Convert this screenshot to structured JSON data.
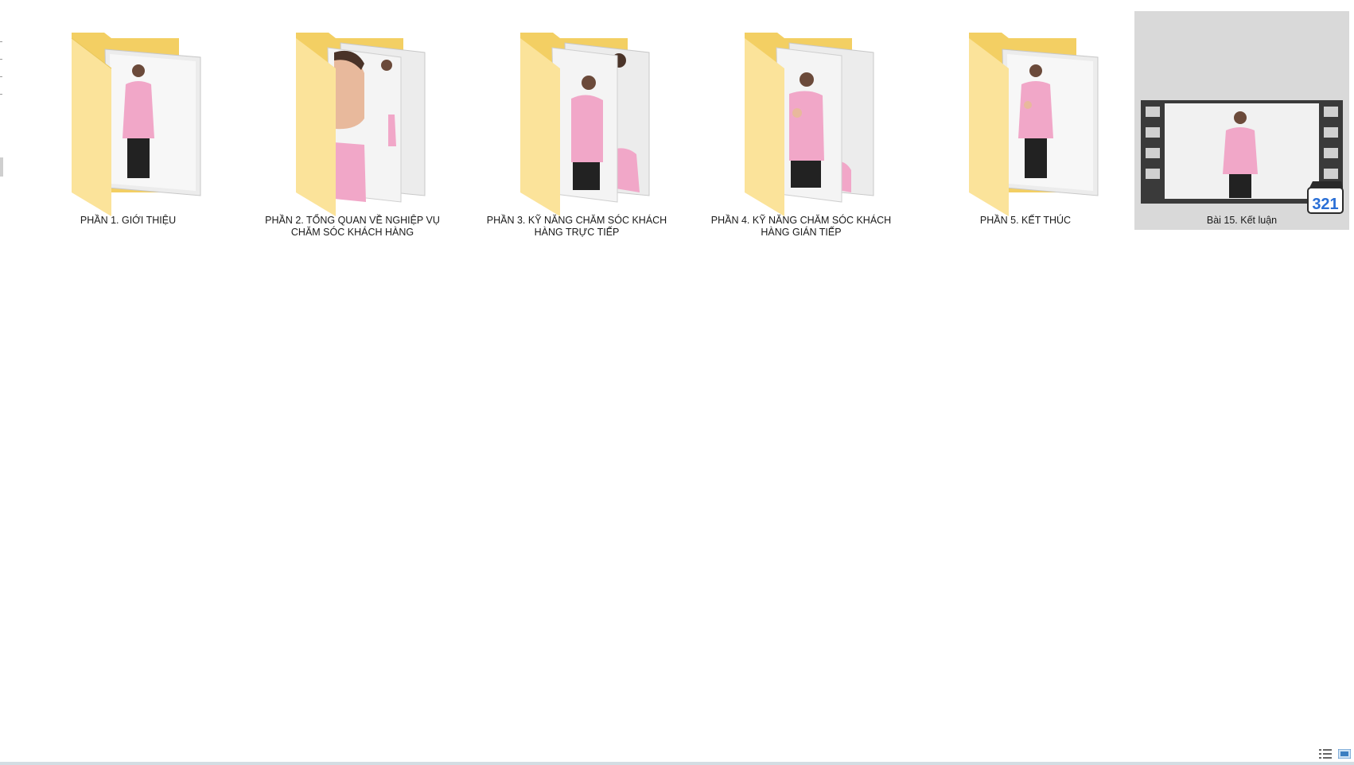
{
  "window": {
    "view_mode": "large-icons"
  },
  "items": [
    {
      "type": "folder",
      "icon": "folder-icon",
      "label": "PHẦN 1. GIỚI THIỆU",
      "selected": false
    },
    {
      "type": "folder",
      "icon": "folder-icon",
      "label": "PHẦN 2. TỔNG QUAN VỀ NGHIỆP VỤ CHĂM SÓC KHÁCH HÀNG",
      "selected": false
    },
    {
      "type": "folder",
      "icon": "folder-icon",
      "label": "PHẦN 3. KỸ NĂNG CHĂM SÓC KHÁCH HÀNG TRỰC TIẾP",
      "selected": false
    },
    {
      "type": "folder",
      "icon": "folder-icon",
      "label": "PHẦN 4. KỸ NĂNG CHĂM SÓC KHÁCH HÀNG GIÁN TIẾP",
      "selected": false
    },
    {
      "type": "folder",
      "icon": "folder-icon",
      "label": "PHẦN 5. KẾT THÚC",
      "selected": false
    },
    {
      "type": "video",
      "icon": "video-file-icon",
      "badge_icon": "media-player-classic-icon",
      "badge_text": "321",
      "label": "Bài 15. Kết luận",
      "selected": true
    }
  ],
  "colors": {
    "folder_back": "#f3cf63",
    "folder_front": "#fbe39a",
    "selection": "#d9d9d9",
    "shirt": "#f1a7c8",
    "film": "#3a3a3a"
  },
  "status_bar": {
    "view_buttons": [
      "details-view-icon",
      "large-icons-view-icon"
    ]
  }
}
